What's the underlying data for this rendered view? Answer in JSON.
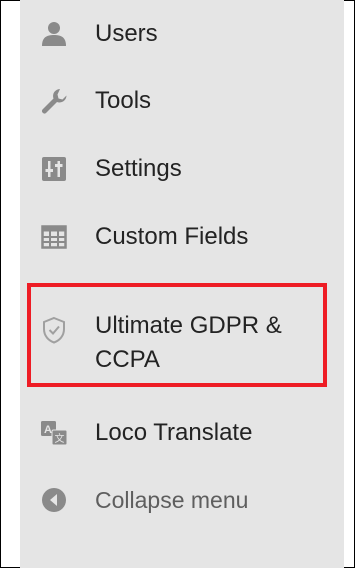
{
  "menu": {
    "items": [
      {
        "label": "Users",
        "icon": "user-icon"
      },
      {
        "label": "Tools",
        "icon": "wrench-icon"
      },
      {
        "label": "Settings",
        "icon": "sliders-icon"
      },
      {
        "label": "Custom Fields",
        "icon": "table-icon"
      },
      {
        "label": "Ultimate GDPR & CCPA",
        "icon": "shield-icon",
        "highlighted": true
      },
      {
        "label": "Loco Translate",
        "icon": "translate-icon"
      },
      {
        "label": "Collapse menu",
        "icon": "collapse-icon"
      }
    ]
  },
  "colors": {
    "menu_bg": "#e5e5e5",
    "text": "#232323",
    "muted_text": "#5e5e5e",
    "icon": "#8a8a8a",
    "highlight_border": "#ee1c25"
  }
}
